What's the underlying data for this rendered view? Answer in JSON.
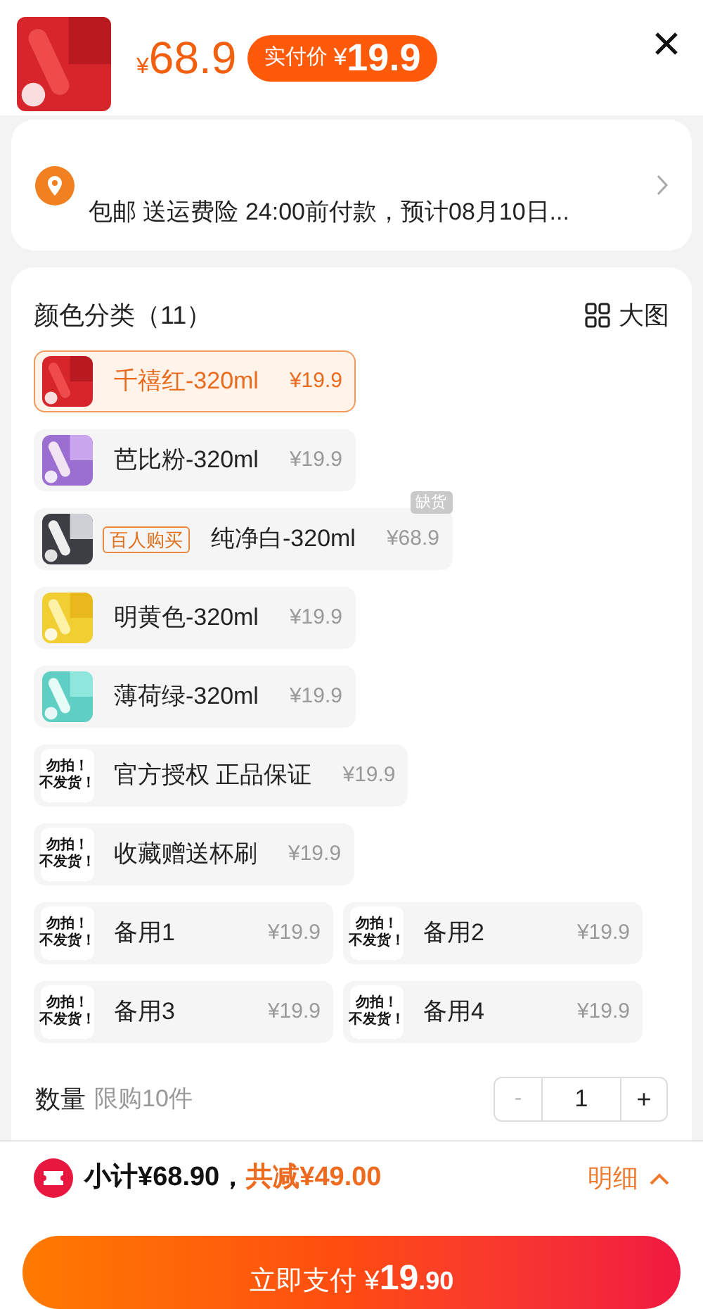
{
  "header": {
    "price": {
      "currency": "¥",
      "amount": "68.9"
    },
    "final_price": {
      "label": "实付价",
      "currency": "¥",
      "amount": "19.9"
    }
  },
  "shipping": {
    "text": "包邮 送运费险 24:00前付款，预计08月10日..."
  },
  "sku": {
    "title": "颜色分类（11）",
    "view_toggle": "大图",
    "options": [
      {
        "kind": "picture",
        "name": "千禧红-320ml",
        "price": "¥19.9",
        "selected": true
      },
      {
        "kind": "picture",
        "name": "芭比粉-320ml",
        "price": "¥19.9",
        "selected": false
      },
      {
        "kind": "picture",
        "name": "纯净白-320ml",
        "price": "¥68.9",
        "selected": false,
        "tag": "百人购买",
        "badge": "缺货"
      },
      {
        "kind": "picture",
        "name": "明黄色-320ml",
        "price": "¥19.9",
        "selected": false
      },
      {
        "kind": "picture",
        "name": "薄荷绿-320ml",
        "price": "¥19.9",
        "selected": false
      },
      {
        "kind": "notice",
        "notice": [
          "勿拍！",
          "不发货！"
        ],
        "name": "官方授权 正品保证",
        "price": "¥19.9",
        "selected": false
      },
      {
        "kind": "notice",
        "notice": [
          "勿拍！",
          "不发货！"
        ],
        "name": "收藏赠送杯刷",
        "price": "¥19.9",
        "selected": false
      },
      {
        "kind": "notice",
        "notice": [
          "勿拍！",
          "不发货！"
        ],
        "name": "备用1",
        "price": "¥19.9",
        "selected": false,
        "half": true
      },
      {
        "kind": "notice",
        "notice": [
          "勿拍！",
          "不发货！"
        ],
        "name": "备用2",
        "price": "¥19.9",
        "selected": false,
        "half": true
      },
      {
        "kind": "notice",
        "notice": [
          "勿拍！",
          "不发货！"
        ],
        "name": "备用3",
        "price": "¥19.9",
        "selected": false,
        "half": true
      },
      {
        "kind": "notice",
        "notice": [
          "勿拍！",
          "不发货！"
        ],
        "name": "备用4",
        "price": "¥19.9",
        "selected": false,
        "half": true
      }
    ]
  },
  "quantity": {
    "label": "数量",
    "limit": "限购10件",
    "minus": "-",
    "value": "1",
    "plus": "+"
  },
  "footer": {
    "subtotal": "小计¥68.90，",
    "discount": "共减¥49.00",
    "details": "明细",
    "pay_button": {
      "label": "立即支付",
      "currency": "¥",
      "integer": "19",
      "decimal": ".90"
    }
  }
}
